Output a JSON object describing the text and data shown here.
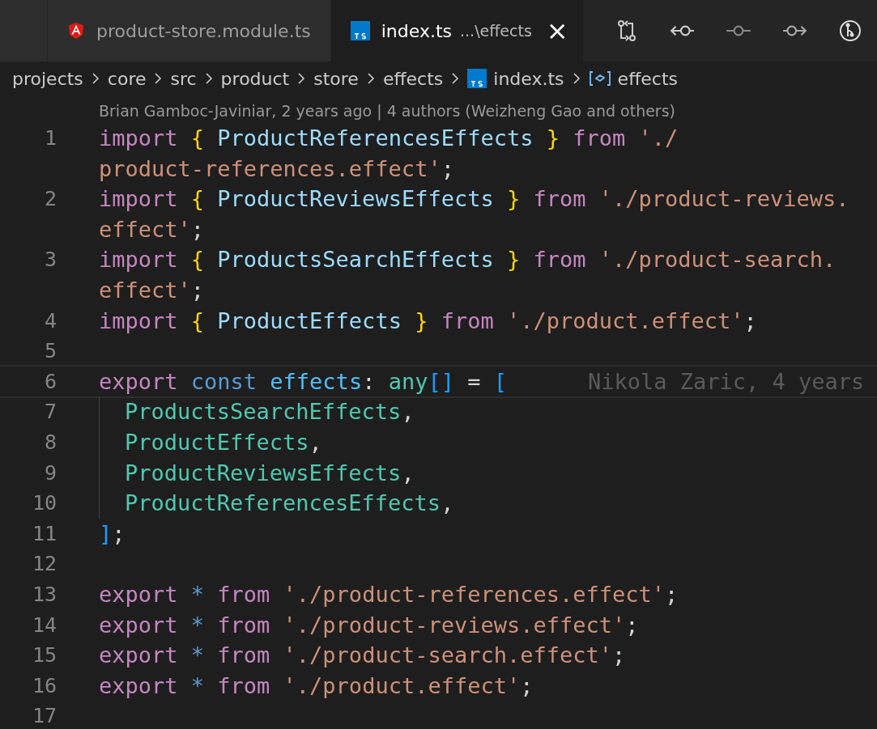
{
  "tabs": [
    {
      "label": "product-store.module.ts",
      "selected": false
    },
    {
      "label": "index.ts",
      "description": "...\\effects",
      "selected": true,
      "close": "×"
    }
  ],
  "breadcrumb": [
    {
      "label": "projects",
      "kind": "folder"
    },
    {
      "label": "core",
      "kind": "folder"
    },
    {
      "label": "src",
      "kind": "folder"
    },
    {
      "label": "product",
      "kind": "folder"
    },
    {
      "label": "store",
      "kind": "folder"
    },
    {
      "label": "effects",
      "kind": "folder"
    },
    {
      "label": "index.ts",
      "kind": "file"
    },
    {
      "label": "effects",
      "kind": "symbol"
    }
  ],
  "blame_header": "Brian Gamboc-Javiniar, 2 years ago | 4 authors (Weizheng Gao and others)",
  "lines": [
    {
      "number": "1",
      "rows": [
        {
          "tokens": [
            {
              "t": "import ",
              "kind": "keyword"
            },
            {
              "t": "{ ",
              "kind": "brace"
            },
            {
              "t": "ProductReferencesEffects",
              "kind": "name"
            },
            {
              "t": " }",
              "kind": "brace"
            },
            {
              "t": " from ",
              "kind": "keyword"
            },
            {
              "t": "'./",
              "kind": "string"
            }
          ]
        },
        {
          "tokens": [
            {
              "t": "product-references.effect'",
              "kind": "string"
            },
            {
              "t": ";",
              "kind": "punct"
            }
          ]
        }
      ]
    },
    {
      "number": "2",
      "rows": [
        {
          "tokens": [
            {
              "t": "import ",
              "kind": "keyword"
            },
            {
              "t": "{ ",
              "kind": "brace"
            },
            {
              "t": "ProductReviewsEffects",
              "kind": "name"
            },
            {
              "t": " }",
              "kind": "brace"
            },
            {
              "t": " from ",
              "kind": "keyword"
            },
            {
              "t": "'./product-reviews.",
              "kind": "string"
            }
          ]
        },
        {
          "tokens": [
            {
              "t": "effect'",
              "kind": "string"
            },
            {
              "t": ";",
              "kind": "punct"
            }
          ]
        }
      ]
    },
    {
      "number": "3",
      "rows": [
        {
          "tokens": [
            {
              "t": "import ",
              "kind": "keyword"
            },
            {
              "t": "{ ",
              "kind": "brace"
            },
            {
              "t": "ProductsSearchEffects",
              "kind": "name"
            },
            {
              "t": " }",
              "kind": "brace"
            },
            {
              "t": " from ",
              "kind": "keyword"
            },
            {
              "t": "'./product-search.",
              "kind": "string"
            }
          ]
        },
        {
          "tokens": [
            {
              "t": "effect'",
              "kind": "string"
            },
            {
              "t": ";",
              "kind": "punct"
            }
          ]
        }
      ]
    },
    {
      "number": "4",
      "rows": [
        {
          "tokens": [
            {
              "t": "import ",
              "kind": "keyword"
            },
            {
              "t": "{ ",
              "kind": "brace"
            },
            {
              "t": "ProductEffects",
              "kind": "name"
            },
            {
              "t": " }",
              "kind": "brace"
            },
            {
              "t": " from ",
              "kind": "keyword"
            },
            {
              "t": "'./product.effect'",
              "kind": "string"
            },
            {
              "t": ";",
              "kind": "punct"
            }
          ]
        }
      ]
    },
    {
      "number": "5"
    },
    {
      "number": "6",
      "current": true,
      "blame": "Nikola Zaric, 4 years",
      "rows": [
        {
          "tokens": [
            {
              "t": "export ",
              "kind": "keyword"
            },
            {
              "t": "const ",
              "kind": "storage"
            },
            {
              "t": "effects",
              "kind": "const"
            },
            {
              "t": ": ",
              "kind": "punct"
            },
            {
              "t": "any",
              "kind": "type"
            },
            {
              "t": "[]",
              "kind": "bracket"
            },
            {
              "t": " = ",
              "kind": "punct"
            },
            {
              "t": "[",
              "kind": "bracket"
            }
          ]
        }
      ]
    },
    {
      "number": "7",
      "current": false,
      "indent": true,
      "rows": [
        {
          "tokens": [
            {
              "t": "ProductsSearchEffects",
              "kind": "type"
            },
            {
              "t": ",",
              "kind": "punct"
            }
          ]
        }
      ]
    },
    {
      "number": "8",
      "current": false,
      "indent": true,
      "rows": [
        {
          "tokens": [
            {
              "t": "ProductEffects",
              "kind": "type"
            },
            {
              "t": ",",
              "kind": "punct"
            }
          ]
        }
      ]
    },
    {
      "number": "9",
      "current": false,
      "indent": true,
      "rows": [
        {
          "tokens": [
            {
              "t": "ProductReviewsEffects",
              "kind": "type"
            },
            {
              "t": ",",
              "kind": "punct"
            }
          ]
        }
      ]
    },
    {
      "number": "10",
      "current": false,
      "indent": true,
      "rows": [
        {
          "tokens": [
            {
              "t": "ProductReferencesEffects",
              "kind": "type"
            },
            {
              "t": ",",
              "kind": "punct"
            }
          ]
        }
      ]
    },
    {
      "number": "11",
      "rows": [
        {
          "tokens": [
            {
              "t": "]",
              "kind": "bracket"
            },
            {
              "t": ";",
              "kind": "punct"
            }
          ]
        }
      ]
    },
    {
      "number": "12"
    },
    {
      "number": "13",
      "rows": [
        {
          "tokens": [
            {
              "t": "export ",
              "kind": "keyword"
            },
            {
              "t": "* ",
              "kind": "storage"
            },
            {
              "t": "from ",
              "kind": "keyword"
            },
            {
              "t": "'./product-references.effect'",
              "kind": "string"
            },
            {
              "t": ";",
              "kind": "punct"
            }
          ]
        }
      ]
    },
    {
      "number": "14",
      "rows": [
        {
          "tokens": [
            {
              "t": "export ",
              "kind": "keyword"
            },
            {
              "t": "* ",
              "kind": "storage"
            },
            {
              "t": "from ",
              "kind": "keyword"
            },
            {
              "t": "'./product-reviews.effect'",
              "kind": "string"
            },
            {
              "t": ";",
              "kind": "punct"
            }
          ]
        }
      ]
    },
    {
      "number": "15",
      "rows": [
        {
          "tokens": [
            {
              "t": "export ",
              "kind": "keyword"
            },
            {
              "t": "* ",
              "kind": "storage"
            },
            {
              "t": "from ",
              "kind": "keyword"
            },
            {
              "t": "'./product-search.effect'",
              "kind": "string"
            },
            {
              "t": ";",
              "kind": "punct"
            }
          ]
        }
      ]
    },
    {
      "number": "16",
      "rows": [
        {
          "tokens": [
            {
              "t": "export ",
              "kind": "keyword"
            },
            {
              "t": "* ",
              "kind": "storage"
            },
            {
              "t": "from ",
              "kind": "keyword"
            },
            {
              "t": "'./product.effect'",
              "kind": "string"
            },
            {
              "t": ";",
              "kind": "punct"
            }
          ]
        }
      ]
    },
    {
      "number": "17"
    }
  ]
}
